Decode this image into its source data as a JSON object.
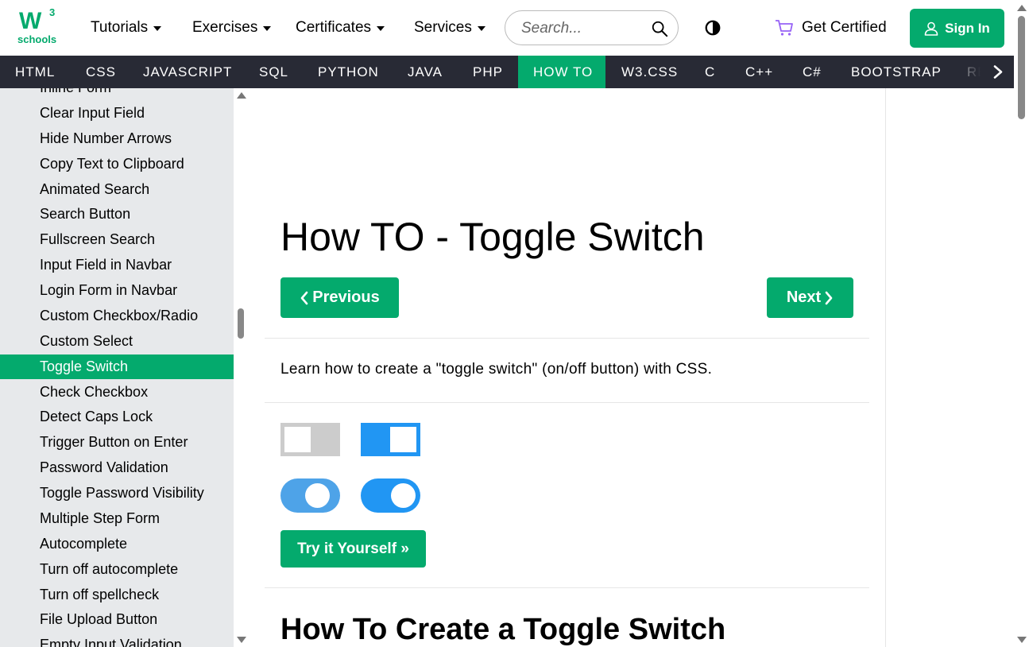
{
  "logo": {
    "mark": "W",
    "superscript": "3",
    "text": "schools"
  },
  "topnav": {
    "items": [
      {
        "label": "Tutorials"
      },
      {
        "label": "Exercises"
      },
      {
        "label": "Certificates"
      },
      {
        "label": "Services"
      }
    ],
    "search_placeholder": "Search...",
    "get_certified": "Get Certified",
    "sign_in": "Sign In"
  },
  "subnav": {
    "items": [
      "HTML",
      "CSS",
      "JAVASCRIPT",
      "SQL",
      "PYTHON",
      "JAVA",
      "PHP",
      "HOW TO",
      "W3.CSS",
      "C",
      "C++",
      "C#",
      "BOOTSTRAP",
      "RE"
    ],
    "active": "HOW TO"
  },
  "sidebar": {
    "items": [
      "Inline Form",
      "Clear Input Field",
      "Hide Number Arrows",
      "Copy Text to Clipboard",
      "Animated Search",
      "Search Button",
      "Fullscreen Search",
      "Input Field in Navbar",
      "Login Form in Navbar",
      "Custom Checkbox/Radio",
      "Custom Select",
      "Toggle Switch",
      "Check Checkbox",
      "Detect Caps Lock",
      "Trigger Button on Enter",
      "Password Validation",
      "Toggle Password Visibility",
      "Multiple Step Form",
      "Autocomplete",
      "Turn off autocomplete",
      "Turn off spellcheck",
      "File Upload Button",
      "Empty Input Validation"
    ],
    "active": "Toggle Switch"
  },
  "main": {
    "title": "How TO - Toggle Switch",
    "previous": "Previous",
    "next": "Next",
    "intro": "Learn how to create a \"toggle switch\" (on/off button) with CSS.",
    "try_it": "Try it Yourself »",
    "section_title": "How To Create a Toggle Switch"
  },
  "toggles": [
    {
      "shape": "square",
      "checked": false,
      "track": "#cccccc"
    },
    {
      "shape": "square",
      "checked": true,
      "track": "#2196F3"
    },
    {
      "shape": "round",
      "checked": true,
      "track": "#4EA3E8"
    },
    {
      "shape": "round",
      "checked": true,
      "track": "#2196F3"
    }
  ],
  "colors": {
    "brand": "#04AA6D",
    "navbar": "#282A35",
    "sidebar": "#E7E9EB"
  }
}
